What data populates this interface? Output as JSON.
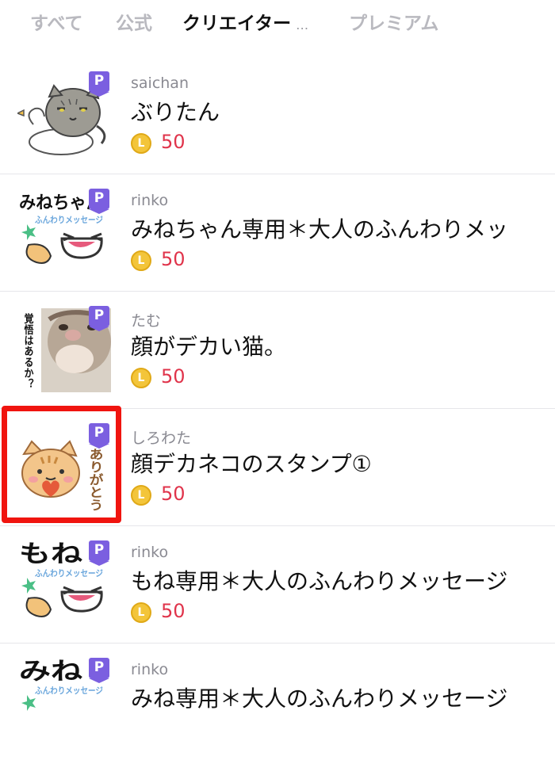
{
  "tabs": [
    {
      "label": "すべて",
      "active": false
    },
    {
      "label": "公式",
      "active": false
    },
    {
      "label": "クリエイター",
      "active": true,
      "ellipsis": "…"
    },
    {
      "label": "プレミアム",
      "active": false
    }
  ],
  "badge_label": "P",
  "coin_symbol": "L",
  "colors": {
    "premium_badge": "#7b5fe0",
    "price": "#e0344b",
    "coin": "#f3c53a",
    "highlight": "#f0140f"
  },
  "items": [
    {
      "creator": "saichan",
      "title": "ぶりたん",
      "price": "50",
      "thumb_icon": "cat-on-duck-sticker"
    },
    {
      "creator": "rinko",
      "title": "みねちゃん専用＊大人のふんわりメッ",
      "price": "50",
      "thumb_icon": "mineちゃん-message-sticker",
      "thumb_text": [
        "みねちゃん",
        "ふんわりメッセージ"
      ]
    },
    {
      "creator": "たむ",
      "title": "顔がデカい猫。",
      "price": "50",
      "thumb_icon": "big-face-cat-photo-sticker",
      "thumb_text": [
        "覚悟はあるか？"
      ]
    },
    {
      "creator": "しろわた",
      "title": "顔デカネコのスタンプ①",
      "price": "50",
      "thumb_icon": "orange-cat-arigatou-sticker",
      "thumb_text": [
        "ありがとう"
      ]
    },
    {
      "creator": "rinko",
      "title": "もね専用＊大人のふんわりメッセージ",
      "price": "50",
      "thumb_icon": "mone-message-sticker",
      "thumb_text": [
        "もね",
        "ふんわりメッセージ"
      ]
    },
    {
      "creator": "rinko",
      "title": "みね専用＊大人のふんわりメッセージ",
      "price": "",
      "thumb_icon": "mine-message-sticker",
      "thumb_text": [
        "みね",
        "ふんわりメッセージ"
      ]
    }
  ]
}
